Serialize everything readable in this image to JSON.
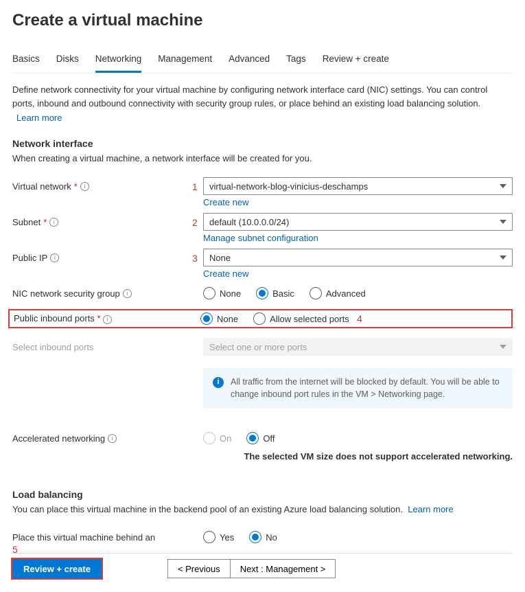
{
  "page_title": "Create a virtual machine",
  "tabs": [
    {
      "label": "Basics",
      "active": false
    },
    {
      "label": "Disks",
      "active": false
    },
    {
      "label": "Networking",
      "active": true
    },
    {
      "label": "Management",
      "active": false
    },
    {
      "label": "Advanced",
      "active": false
    },
    {
      "label": "Tags",
      "active": false
    },
    {
      "label": "Review + create",
      "active": false
    }
  ],
  "intro_text": "Define network connectivity for your virtual machine by configuring network interface card (NIC) settings. You can control ports, inbound and outbound connectivity with security group rules, or place behind an existing load balancing solution.",
  "intro_learn_more": "Learn more",
  "network_interface": {
    "title": "Network interface",
    "subtitle": "When creating a virtual machine, a network interface will be created for you."
  },
  "annotations": {
    "a1": "1",
    "a2": "2",
    "a3": "3",
    "a4": "4",
    "a5": "5"
  },
  "fields": {
    "vnet": {
      "label": "Virtual network",
      "required": true,
      "value": "virtual-network-blog-vinicius-deschamps",
      "below_link": "Create new"
    },
    "subnet": {
      "label": "Subnet",
      "required": true,
      "value": "default (10.0.0.0/24)",
      "below_link": "Manage subnet configuration"
    },
    "public_ip": {
      "label": "Public IP",
      "required": false,
      "value": "None",
      "below_link": "Create new"
    },
    "nsg": {
      "label": "NIC network security group",
      "options": [
        "None",
        "Basic",
        "Advanced"
      ],
      "selected": "Basic"
    },
    "inbound_ports": {
      "label": "Public inbound ports",
      "required": true,
      "options": [
        "None",
        "Allow selected ports"
      ],
      "selected": "None"
    },
    "select_inbound": {
      "label": "Select inbound ports",
      "placeholder": "Select one or more ports"
    },
    "info_text": "All traffic from the internet will be blocked by default. You will be able to change inbound port rules in the VM > Networking page.",
    "accel_net": {
      "label": "Accelerated networking",
      "options": [
        "On",
        "Off"
      ],
      "selected": "Off",
      "disabled_option": "On",
      "note": "The selected VM size does not support accelerated networking."
    }
  },
  "load_balancing": {
    "title": "Load balancing",
    "text": "You can place this virtual machine in the backend pool of an existing Azure load balancing solution.",
    "learn_more": "Learn more",
    "place_label": "Place this virtual machine behind an",
    "options": [
      "Yes",
      "No"
    ],
    "selected": "No"
  },
  "footer": {
    "review": "Review + create",
    "previous": "< Previous",
    "next": "Next : Management >"
  }
}
